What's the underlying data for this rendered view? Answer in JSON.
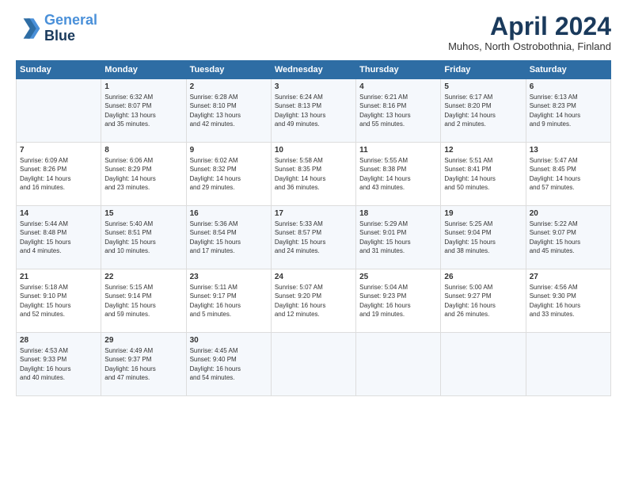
{
  "logo": {
    "line1": "General",
    "line2": "Blue"
  },
  "title": "April 2024",
  "location": "Muhos, North Ostrobothnia, Finland",
  "days_header": [
    "Sunday",
    "Monday",
    "Tuesday",
    "Wednesday",
    "Thursday",
    "Friday",
    "Saturday"
  ],
  "weeks": [
    [
      {
        "day": "",
        "info": ""
      },
      {
        "day": "1",
        "info": "Sunrise: 6:32 AM\nSunset: 8:07 PM\nDaylight: 13 hours\nand 35 minutes."
      },
      {
        "day": "2",
        "info": "Sunrise: 6:28 AM\nSunset: 8:10 PM\nDaylight: 13 hours\nand 42 minutes."
      },
      {
        "day": "3",
        "info": "Sunrise: 6:24 AM\nSunset: 8:13 PM\nDaylight: 13 hours\nand 49 minutes."
      },
      {
        "day": "4",
        "info": "Sunrise: 6:21 AM\nSunset: 8:16 PM\nDaylight: 13 hours\nand 55 minutes."
      },
      {
        "day": "5",
        "info": "Sunrise: 6:17 AM\nSunset: 8:20 PM\nDaylight: 14 hours\nand 2 minutes."
      },
      {
        "day": "6",
        "info": "Sunrise: 6:13 AM\nSunset: 8:23 PM\nDaylight: 14 hours\nand 9 minutes."
      }
    ],
    [
      {
        "day": "7",
        "info": "Sunrise: 6:09 AM\nSunset: 8:26 PM\nDaylight: 14 hours\nand 16 minutes."
      },
      {
        "day": "8",
        "info": "Sunrise: 6:06 AM\nSunset: 8:29 PM\nDaylight: 14 hours\nand 23 minutes."
      },
      {
        "day": "9",
        "info": "Sunrise: 6:02 AM\nSunset: 8:32 PM\nDaylight: 14 hours\nand 29 minutes."
      },
      {
        "day": "10",
        "info": "Sunrise: 5:58 AM\nSunset: 8:35 PM\nDaylight: 14 hours\nand 36 minutes."
      },
      {
        "day": "11",
        "info": "Sunrise: 5:55 AM\nSunset: 8:38 PM\nDaylight: 14 hours\nand 43 minutes."
      },
      {
        "day": "12",
        "info": "Sunrise: 5:51 AM\nSunset: 8:41 PM\nDaylight: 14 hours\nand 50 minutes."
      },
      {
        "day": "13",
        "info": "Sunrise: 5:47 AM\nSunset: 8:45 PM\nDaylight: 14 hours\nand 57 minutes."
      }
    ],
    [
      {
        "day": "14",
        "info": "Sunrise: 5:44 AM\nSunset: 8:48 PM\nDaylight: 15 hours\nand 4 minutes."
      },
      {
        "day": "15",
        "info": "Sunrise: 5:40 AM\nSunset: 8:51 PM\nDaylight: 15 hours\nand 10 minutes."
      },
      {
        "day": "16",
        "info": "Sunrise: 5:36 AM\nSunset: 8:54 PM\nDaylight: 15 hours\nand 17 minutes."
      },
      {
        "day": "17",
        "info": "Sunrise: 5:33 AM\nSunset: 8:57 PM\nDaylight: 15 hours\nand 24 minutes."
      },
      {
        "day": "18",
        "info": "Sunrise: 5:29 AM\nSunset: 9:01 PM\nDaylight: 15 hours\nand 31 minutes."
      },
      {
        "day": "19",
        "info": "Sunrise: 5:25 AM\nSunset: 9:04 PM\nDaylight: 15 hours\nand 38 minutes."
      },
      {
        "day": "20",
        "info": "Sunrise: 5:22 AM\nSunset: 9:07 PM\nDaylight: 15 hours\nand 45 minutes."
      }
    ],
    [
      {
        "day": "21",
        "info": "Sunrise: 5:18 AM\nSunset: 9:10 PM\nDaylight: 15 hours\nand 52 minutes."
      },
      {
        "day": "22",
        "info": "Sunrise: 5:15 AM\nSunset: 9:14 PM\nDaylight: 15 hours\nand 59 minutes."
      },
      {
        "day": "23",
        "info": "Sunrise: 5:11 AM\nSunset: 9:17 PM\nDaylight: 16 hours\nand 5 minutes."
      },
      {
        "day": "24",
        "info": "Sunrise: 5:07 AM\nSunset: 9:20 PM\nDaylight: 16 hours\nand 12 minutes."
      },
      {
        "day": "25",
        "info": "Sunrise: 5:04 AM\nSunset: 9:23 PM\nDaylight: 16 hours\nand 19 minutes."
      },
      {
        "day": "26",
        "info": "Sunrise: 5:00 AM\nSunset: 9:27 PM\nDaylight: 16 hours\nand 26 minutes."
      },
      {
        "day": "27",
        "info": "Sunrise: 4:56 AM\nSunset: 9:30 PM\nDaylight: 16 hours\nand 33 minutes."
      }
    ],
    [
      {
        "day": "28",
        "info": "Sunrise: 4:53 AM\nSunset: 9:33 PM\nDaylight: 16 hours\nand 40 minutes."
      },
      {
        "day": "29",
        "info": "Sunrise: 4:49 AM\nSunset: 9:37 PM\nDaylight: 16 hours\nand 47 minutes."
      },
      {
        "day": "30",
        "info": "Sunrise: 4:45 AM\nSunset: 9:40 PM\nDaylight: 16 hours\nand 54 minutes."
      },
      {
        "day": "",
        "info": ""
      },
      {
        "day": "",
        "info": ""
      },
      {
        "day": "",
        "info": ""
      },
      {
        "day": "",
        "info": ""
      }
    ]
  ]
}
